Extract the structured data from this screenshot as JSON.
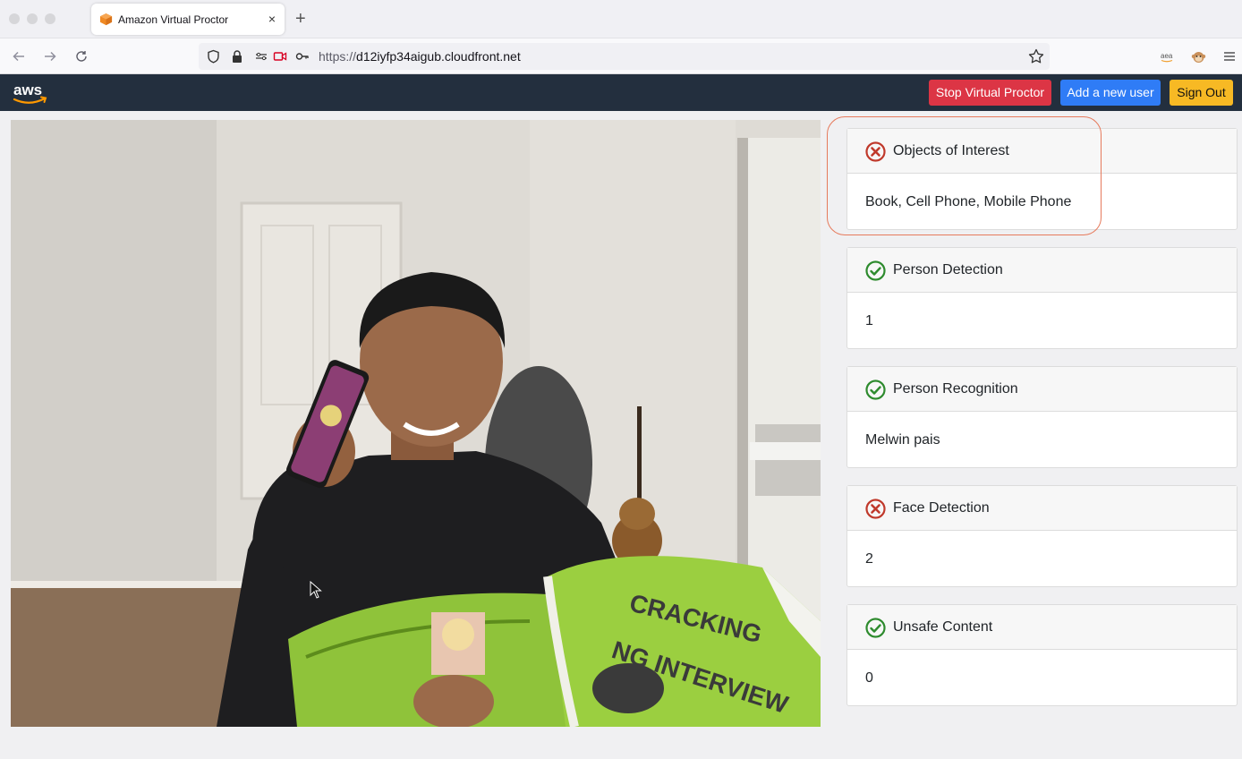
{
  "browser": {
    "tab_title": "Amazon Virtual Proctor",
    "new_tab": "+",
    "tab_close": "×",
    "url_scheme": "https://",
    "url_host": "d12iyfp34aigub.cloudfront.net",
    "extensions": [
      "aea"
    ]
  },
  "header": {
    "logo_text": "aws",
    "stop_label": "Stop Virtual Proctor",
    "add_user_label": "Add a new user",
    "sign_out_label": "Sign Out"
  },
  "colors": {
    "header_bg": "#232f3e",
    "stop": "#dc3545",
    "add": "#2f7cf6",
    "sign_out": "#f7b924",
    "fail": "#c0392b",
    "pass": "#2e8b2e",
    "highlight": "#e67a5c"
  },
  "video": {
    "book_title_1": "CRACKING",
    "book_title_2": "NG INTERVIEW"
  },
  "checks": [
    {
      "title": "Objects of Interest",
      "value": "Book, Cell Phone, Mobile Phone",
      "status": "fail",
      "icon": "x-circle-icon"
    },
    {
      "title": "Person Detection",
      "value": "1",
      "status": "pass",
      "icon": "check-circle-icon"
    },
    {
      "title": "Person Recognition",
      "value": "Melwin pais",
      "status": "pass",
      "icon": "check-circle-icon"
    },
    {
      "title": "Face Detection",
      "value": "2",
      "status": "fail",
      "icon": "x-circle-icon"
    },
    {
      "title": "Unsafe Content",
      "value": "0",
      "status": "pass",
      "icon": "check-circle-icon"
    }
  ]
}
